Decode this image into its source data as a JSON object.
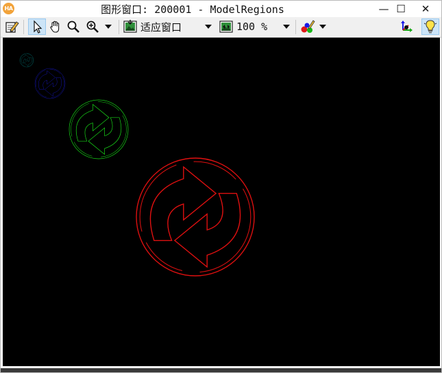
{
  "window": {
    "title": "图形窗口: 200001 - ModelRegions",
    "app_icon_label": "HA",
    "minimize_symbol": "—",
    "maximize_symbol": "☐",
    "close_symbol": "✕"
  },
  "toolbar": {
    "tools": [
      {
        "name": "edit-properties",
        "icon": "pencil-icon"
      },
      {
        "name": "select",
        "icon": "pointer-arrow-icon",
        "selected": true
      },
      {
        "name": "pan",
        "icon": "hand-icon"
      },
      {
        "name": "zoom",
        "icon": "magnifier-icon"
      },
      {
        "name": "zoom-options",
        "icon": "magnifier-plus-icon"
      }
    ],
    "fit_mode_label": "适应窗口",
    "zoom_label": "100 %",
    "draw_options_icon": "color-brush-icon",
    "right_icons": [
      "axis-icon",
      "lightbulb-icon"
    ]
  },
  "canvas": {
    "background": "#000000",
    "regions": [
      {
        "name": "model-region-cyan",
        "color": "#00e5e5"
      },
      {
        "name": "model-region-blue",
        "color": "#1c1cf2"
      },
      {
        "name": "model-region-green",
        "color": "#18d818"
      },
      {
        "name": "model-region-red",
        "color": "#e01010"
      }
    ]
  }
}
